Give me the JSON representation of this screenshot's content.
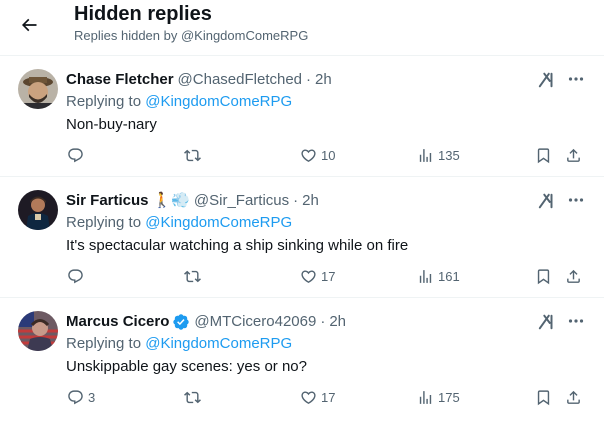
{
  "header": {
    "title": "Hidden replies",
    "subtitle": "Replies hidden by @KingdomComeRPG"
  },
  "replying_prefix": "Replying to",
  "tweets": [
    {
      "name": "Chase Fletcher",
      "handle": "@ChasedFletched",
      "dot": "·",
      "time": "2h",
      "replying_to": "@KingdomComeRPG",
      "text": "Non-buy-nary",
      "replies": "",
      "retweets": "",
      "likes": "10",
      "views": "135"
    },
    {
      "name": "Sir Farticus",
      "handle": "@Sir_Farticus",
      "dot": "·",
      "time": "2h",
      "emoji": "🚶💨",
      "replying_to": "@KingdomComeRPG",
      "text": "It's spectacular watching a ship sinking while on fire",
      "replies": "",
      "retweets": "",
      "likes": "17",
      "views": "161"
    },
    {
      "name": "Marcus Cicero",
      "handle": "@MTCicero42069",
      "dot": "·",
      "time": "2h",
      "verified": true,
      "replying_to": "@KingdomComeRPG",
      "text": "Unskippable gay scenes: yes or no?",
      "replies": "3",
      "retweets": "",
      "likes": "17",
      "views": "175"
    }
  ],
  "colors": {
    "link": "#1d9bf0",
    "secondary": "#536471",
    "primary": "#0f1419",
    "verified": "#1d9bf0"
  }
}
